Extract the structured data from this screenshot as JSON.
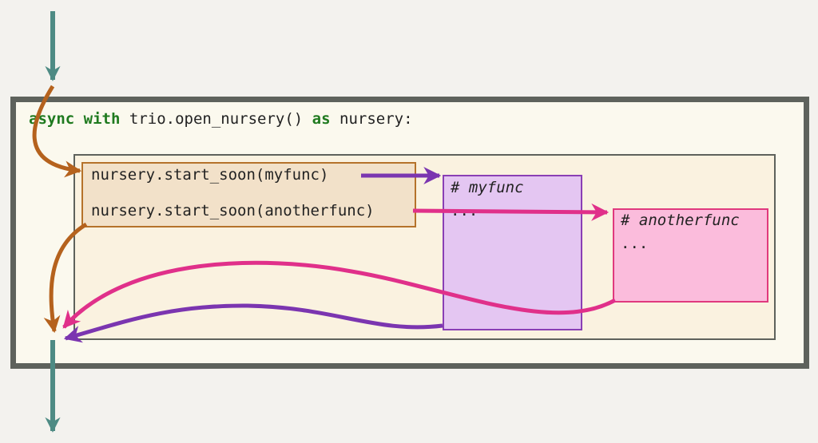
{
  "header": {
    "kw_async": "async",
    "kw_with": "with",
    "call": "trio.open_nursery()",
    "kw_as": "as",
    "target": "nursery:"
  },
  "parent_task": {
    "line1": "nursery.start_soon(myfunc)",
    "line2": "nursery.start_soon(anotherfunc)"
  },
  "child_myfunc": {
    "comment": "# myfunc",
    "body": "..."
  },
  "child_anotherfunc": {
    "comment": "# anotherfunc",
    "body": "..."
  },
  "colors": {
    "control_flow": "#4e8b84",
    "parent_flow": "#b5621d",
    "myfunc_flow": "#7b35b0",
    "anotherfunc_flow": "#e0308a",
    "keyword": "#1f7a1f"
  }
}
